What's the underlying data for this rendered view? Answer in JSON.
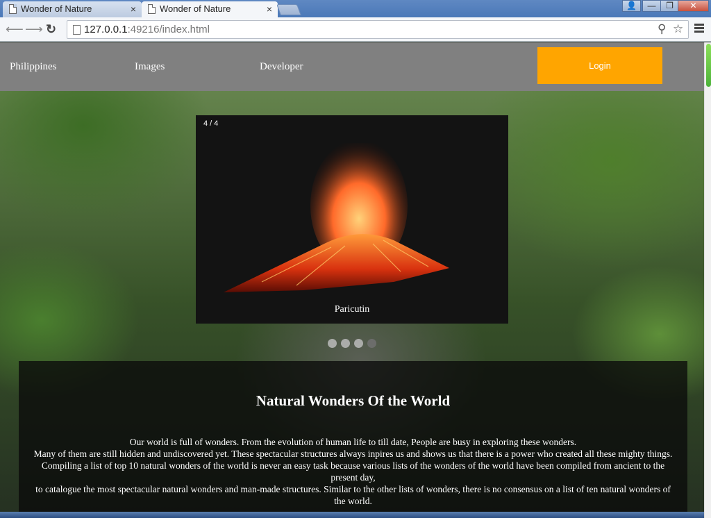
{
  "browser": {
    "tabs": [
      {
        "title": "Wonder of Nature",
        "close": "×"
      },
      {
        "title": "Wonder of Nature",
        "close": "×"
      }
    ],
    "window_buttons": {
      "user": "👤",
      "minimize": "—",
      "restore": "❐",
      "close": "✕"
    },
    "url_host": "127.0.0.1",
    "url_rest": ":49216/index.html"
  },
  "nav": {
    "items": [
      {
        "label": "Philippines "
      },
      {
        "label": "Images "
      },
      {
        "label": "Developer "
      }
    ],
    "login_label": "Login "
  },
  "slideshow": {
    "counter": "4 / 4",
    "caption": "Paricutin",
    "slide_count": 4,
    "active_slide": 4
  },
  "content": {
    "title": "Natural Wonders Of the World",
    "paragraphs": [
      "Our world is full of wonders. From the evolution of human life to till date, People are busy in exploring these wonders.",
      "Many of them are still hidden and undiscovered yet. These spectacular structures always inpires us and shows us that there is a power who created all these mighty things.",
      "Compiling a list of top 10 natural wonders of the world is never an easy task because various lists of the wonders of the world have been compiled from ancient to the present day,",
      "to catalogue the most spectacular natural wonders and man-made structures. Similar to the other lists of wonders, there is no consensus on a list of ten natural wonders of the world."
    ]
  },
  "colors": {
    "nav_bg": "#808080",
    "login_bg": "#ffa500",
    "panel_bg": "rgba(10,10,10,0.78)"
  }
}
